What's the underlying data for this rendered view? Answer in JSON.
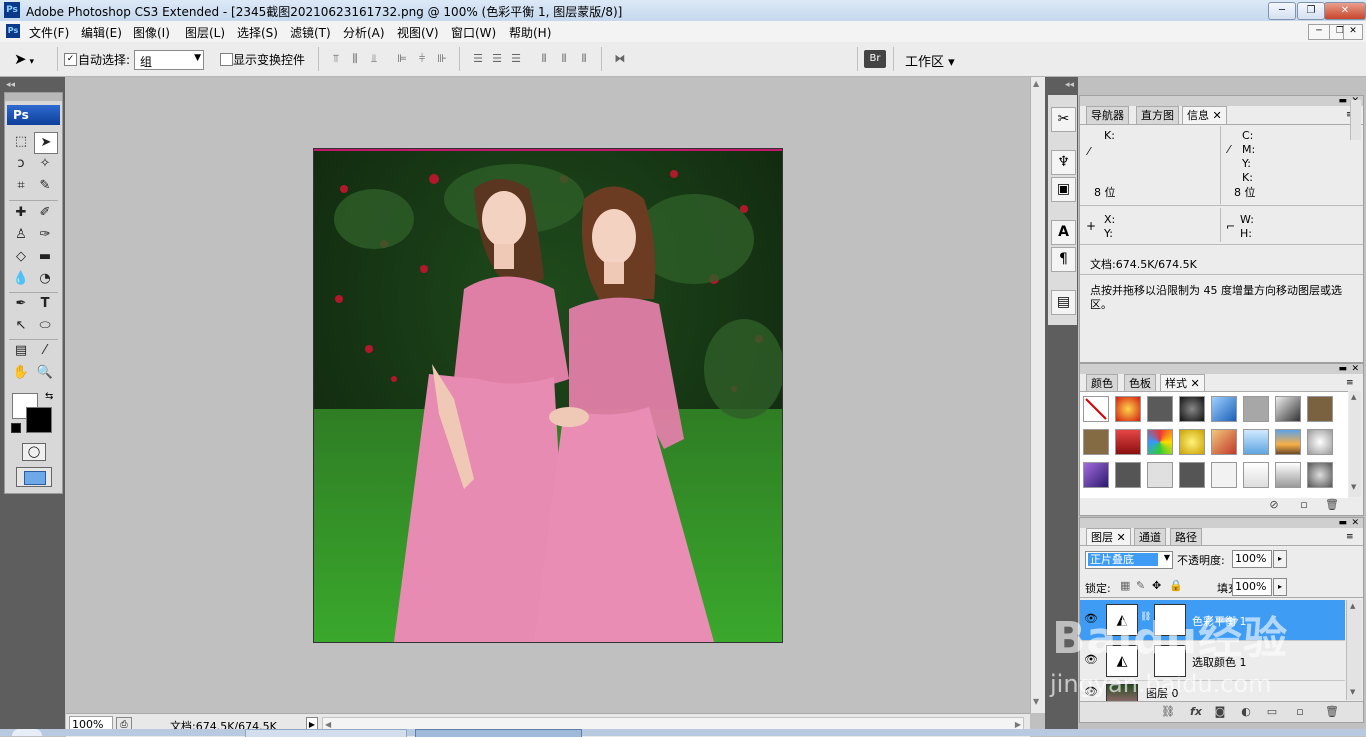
{
  "window": {
    "title": "Adobe Photoshop CS3 Extended - [2345截图20210623161732.png @ 100% (色彩平衡 1, 图层蒙版/8)]",
    "app_badge": "Ps",
    "minimize": "─",
    "restore": "❐",
    "close": "✕"
  },
  "menu": {
    "items": [
      "文件(F)",
      "编辑(E)",
      "图像(I)",
      "图层(L)",
      "选择(S)",
      "滤镜(T)",
      "分析(A)",
      "视图(V)",
      "窗口(W)",
      "帮助(H)"
    ],
    "doc_minimize": "─",
    "doc_restore": "❐",
    "doc_close": "✕"
  },
  "options": {
    "auto_select_label": "自动选择:",
    "auto_select_checked": "✓",
    "auto_select_value": "组",
    "show_transform_label": "显示变换控件",
    "workspace_label": "工作区 ▾"
  },
  "toolbox": {
    "logo": "Ps"
  },
  "status": {
    "zoom": "100%",
    "doc_info": "文档:674.5K/674.5K"
  },
  "info_panel": {
    "tabs": [
      "导航器",
      "直方图",
      "信息"
    ],
    "k_label": "K:",
    "c_label": "C:",
    "m_label": "M:",
    "y_label": "Y:",
    "k2_label": "K:",
    "bit_left": "8 位",
    "bit_right": "8 位",
    "x_label": "X:",
    "y2_label": "Y:",
    "w_label": "W:",
    "h_label": "H:",
    "doc": "文档:674.5K/674.5K",
    "hint": "点按并拖移以沿限制为 45 度增量方向移动图层或选区。"
  },
  "styles_panel": {
    "tabs": [
      "颜色",
      "色板",
      "样式"
    ]
  },
  "layers_panel": {
    "tabs": [
      "图层",
      "通道",
      "路径"
    ],
    "blend_mode": "正片叠底",
    "opacity_label": "不透明度:",
    "opacity_value": "100%",
    "lock_label": "锁定:",
    "fill_label": "填充:",
    "fill_value": "100%",
    "layers": [
      {
        "name": "色彩平衡 1"
      },
      {
        "name": "选取颜色 1"
      },
      {
        "name": "图层 0"
      }
    ]
  },
  "watermark": {
    "brand": "Baidu经验",
    "url": "jingyan.baidu.com"
  },
  "colors": {
    "accent": "#3f9cf5",
    "titlebar": "#c5d8ee",
    "panel_dark": "#5e5e5e",
    "canvas_bg": "#c0c0c0"
  }
}
